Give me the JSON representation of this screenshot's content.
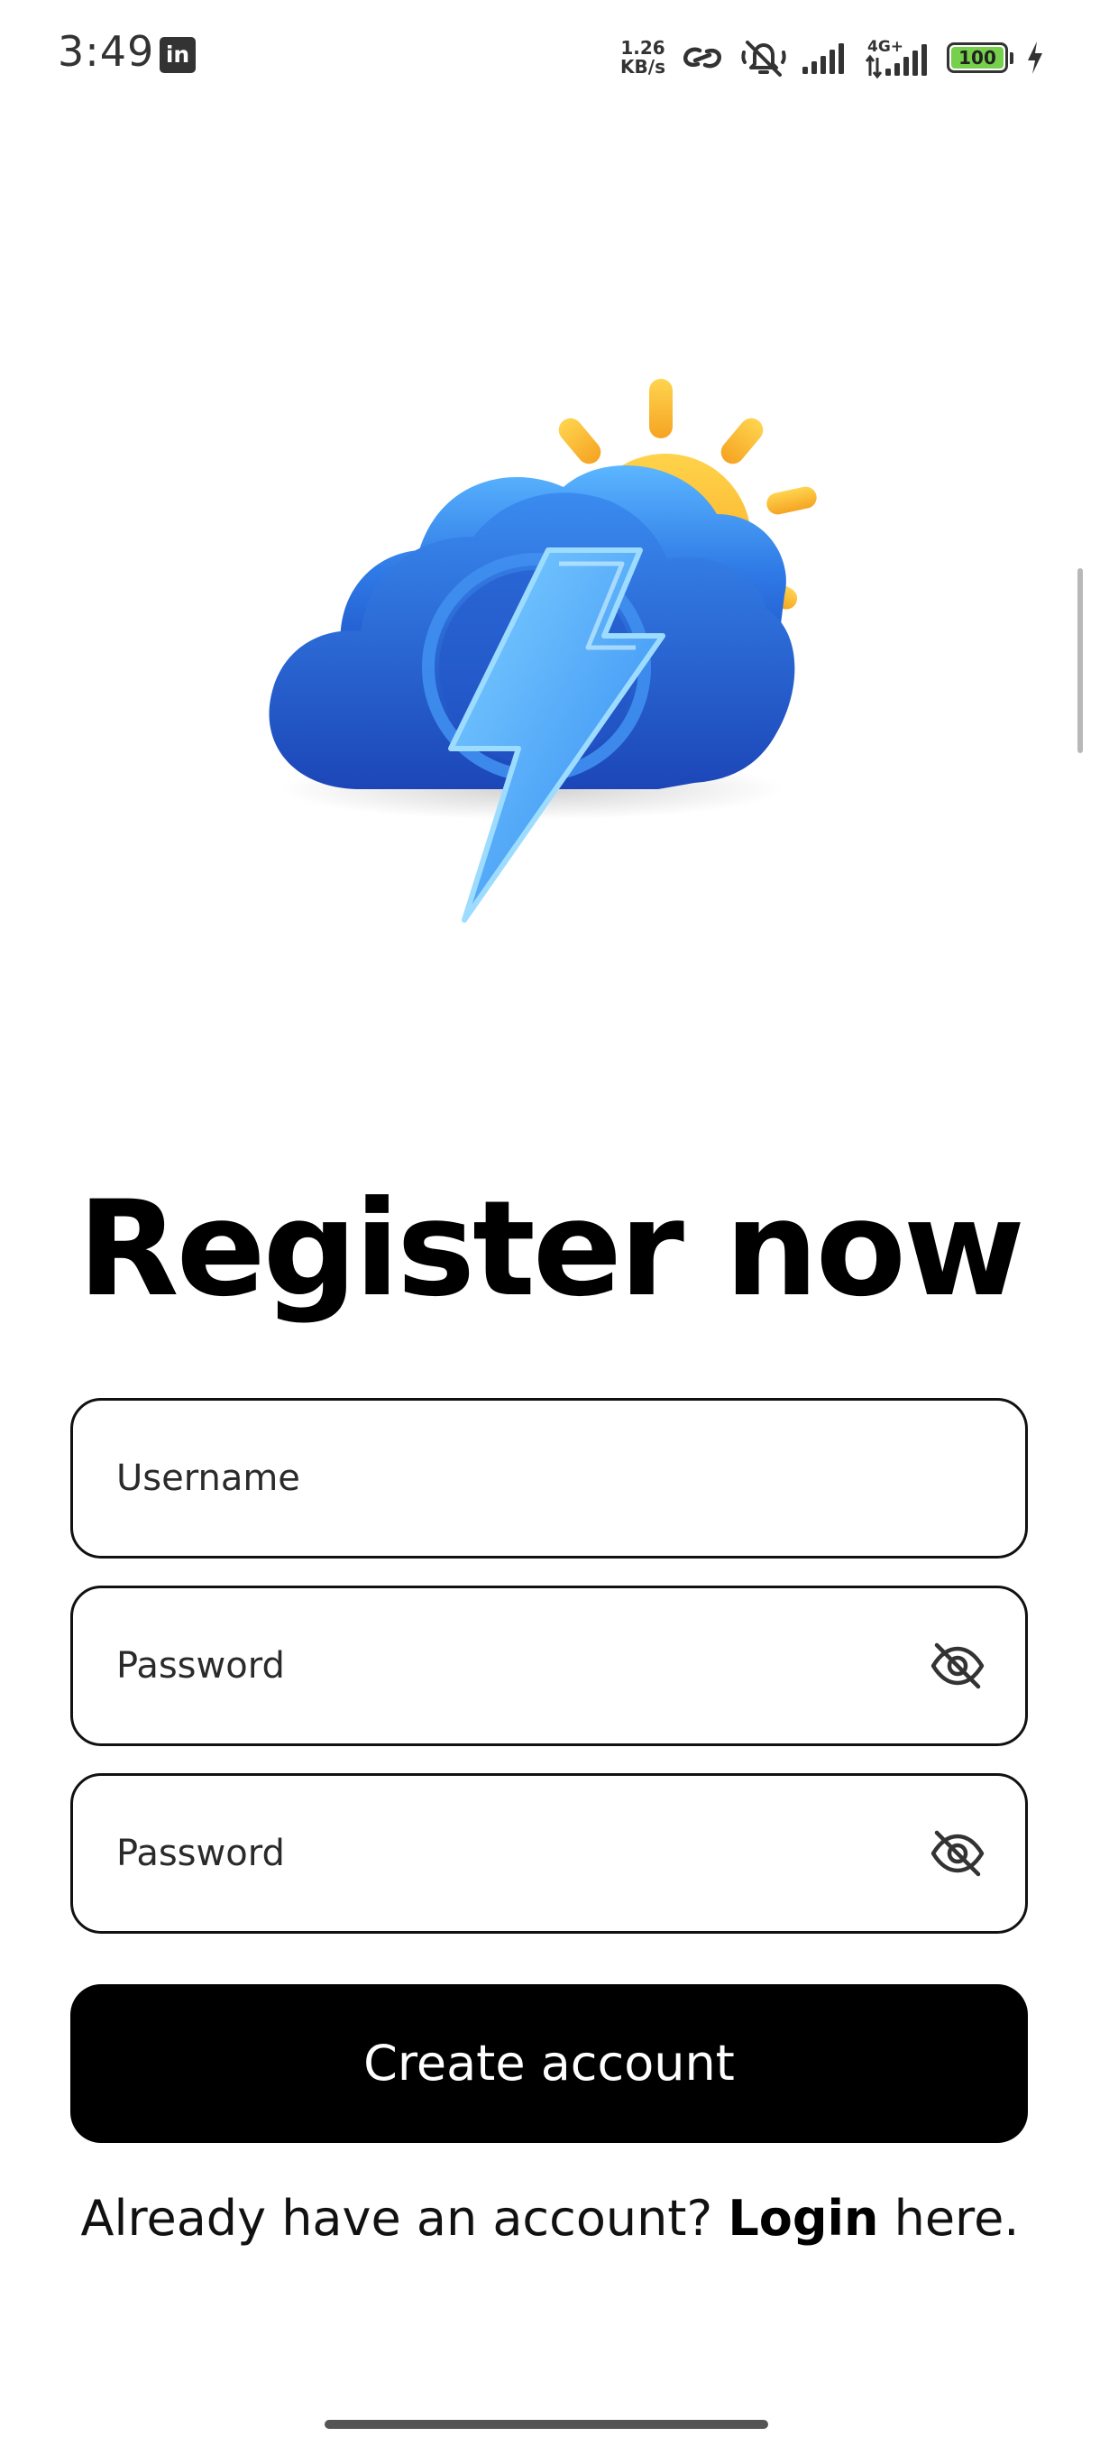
{
  "status_bar": {
    "time": "3:49",
    "notification_app": "in",
    "net_speed_value": "1.26",
    "net_speed_unit": "KB/s",
    "network_type": "4G+",
    "battery_level": "100",
    "icons": [
      "linkedin-icon",
      "hotspot-link-icon",
      "mute-icon",
      "signal-icon",
      "signal-4g-icon",
      "battery-icon",
      "charging-icon"
    ],
    "battery_color": "#76d04b"
  },
  "logo": {
    "icon": "weather-storm-sun-logo",
    "colors": {
      "cloud": "#2f6fe0",
      "sun": "#ffc02a",
      "bolt": "#5bb3ff"
    }
  },
  "page": {
    "title": "Register now"
  },
  "form": {
    "username": {
      "placeholder": "Username",
      "value": ""
    },
    "password": {
      "placeholder": "Password",
      "value": ""
    },
    "confirm_password": {
      "placeholder": "Password",
      "value": ""
    },
    "visibility_icon": "eye-off-icon",
    "submit_label": "Create account"
  },
  "footer": {
    "prefix": "Already have an account?",
    "link_label": "Login",
    "suffix": "here."
  },
  "theme": {
    "primary": "#000000",
    "background": "#ffffff",
    "on_primary": "#ffffff"
  }
}
